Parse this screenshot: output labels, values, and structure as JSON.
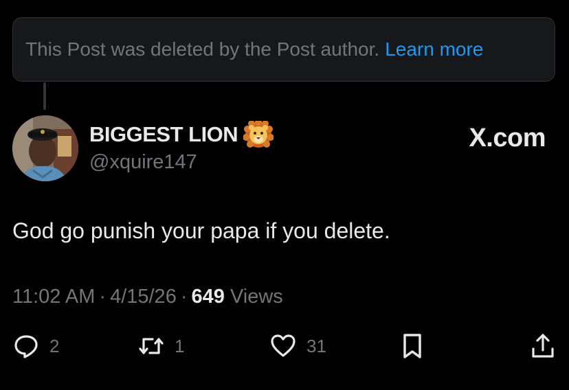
{
  "deleted_notice": {
    "message": "This Post was deleted by the Post author.",
    "link": "Learn more"
  },
  "author": {
    "display_name": "BIGGEST LION",
    "badge_emoji": "lion-face-icon",
    "handle": "@xquire147"
  },
  "brand": "X.com",
  "post": {
    "text": "God go punish your papa if you delete."
  },
  "meta": {
    "time": "11:02 AM",
    "date": "4/15/26",
    "views_count": "649",
    "views_label": "Views"
  },
  "actions": {
    "replies": "2",
    "reposts": "1",
    "likes": "31"
  },
  "colors": {
    "background": "#000000",
    "primary_text": "#e7e9ea",
    "secondary_text": "#71767b",
    "link": "#1d9bf0",
    "banner_bg": "#16181c",
    "border": "#2f3336"
  }
}
